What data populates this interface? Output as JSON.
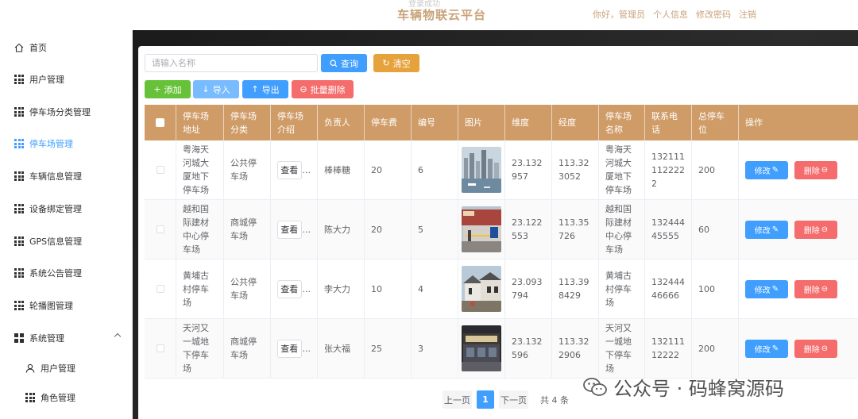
{
  "header": {
    "ghost_text": "登录成功",
    "title": "车辆物联云平台",
    "greeting": "你好，管理员",
    "profile": "个人信息",
    "change_password": "修改密码",
    "logout": "注销"
  },
  "sidebar": {
    "items": [
      {
        "label": "首页",
        "icon": "home-icon"
      },
      {
        "label": "用户管理",
        "icon": "grid-icon"
      },
      {
        "label": "停车场分类管理",
        "icon": "grid-icon"
      },
      {
        "label": "停车场管理",
        "icon": "grid-icon",
        "active": true
      },
      {
        "label": "车辆信息管理",
        "icon": "grid-icon"
      },
      {
        "label": "设备绑定管理",
        "icon": "grid-icon"
      },
      {
        "label": "GPS信息管理",
        "icon": "grid-icon"
      },
      {
        "label": "系统公告管理",
        "icon": "grid-icon"
      },
      {
        "label": "轮播图管理",
        "icon": "grid-icon"
      },
      {
        "label": "系统管理",
        "icon": "apps-icon",
        "expanded": true
      },
      {
        "label": "用户管理",
        "icon": "user-icon",
        "sub": true
      },
      {
        "label": "角色管理",
        "icon": "grid-icon",
        "sub": true
      }
    ]
  },
  "toolbar": {
    "search_placeholder": "请输入名称",
    "query_label": "查询",
    "clear_label": "清空",
    "add_label": "添加",
    "import_label": "导入",
    "export_label": "导出",
    "batch_delete_label": "批量删除"
  },
  "table": {
    "headers": [
      "停车场地址",
      "停车场分类",
      "停车场介绍",
      "负责人",
      "停车费",
      "编号",
      "图片",
      "维度",
      "经度",
      "停车场名称",
      "联系电话",
      "总停车位",
      "操作"
    ],
    "view_label": "查看",
    "ellipsis": "...",
    "edit_label": "修改",
    "delete_label": "删除",
    "rows": [
      {
        "address": "粤海天河城大厦地下停车场",
        "category": "公共停车场",
        "manager": "棒棒糖",
        "fee": "20",
        "number": "6",
        "lat": "23.132957",
        "lng": "113.323052",
        "name": "粤海天河城大厦地下停车场",
        "phone": "1321111122222",
        "spaces": "200",
        "image": "harbor-skyline"
      },
      {
        "address": "越和国际建材中心停车场",
        "category": "商城停车场",
        "manager": "陈大力",
        "fee": "20",
        "number": "5",
        "lat": "23.122553",
        "lng": "113.35726",
        "name": "越和国际建材中心停车场",
        "phone": "13244445555",
        "spaces": "60",
        "image": "parking-gate"
      },
      {
        "address": "黄埔古村停车场",
        "category": "公共停车场",
        "manager": "李大力",
        "fee": "10",
        "number": "4",
        "lat": "23.093794",
        "lng": "113.398429",
        "name": "黄埔古村停车场",
        "phone": "13244446666",
        "spaces": "100",
        "image": "old-village"
      },
      {
        "address": "天河又一城地下停车场",
        "category": "商城停车场",
        "manager": "张大福",
        "fee": "25",
        "number": "3",
        "lat": "23.132596",
        "lng": "113.322906",
        "name": "天河又一城地下停车场",
        "phone": "13211112222",
        "spaces": "200",
        "image": "mall-sign"
      }
    ]
  },
  "pagination": {
    "prev": "上一页",
    "current": "1",
    "next": "下一页",
    "total": "共 4 条"
  },
  "watermark": {
    "text": "公众号 · 码蜂窝源码"
  },
  "colors": {
    "accent": "#409eff",
    "header_bg": "#cf9b66",
    "brand_text": "#c9a37a",
    "warning": "#e6a23c",
    "success": "#67c23a",
    "danger": "#f56c6c"
  }
}
